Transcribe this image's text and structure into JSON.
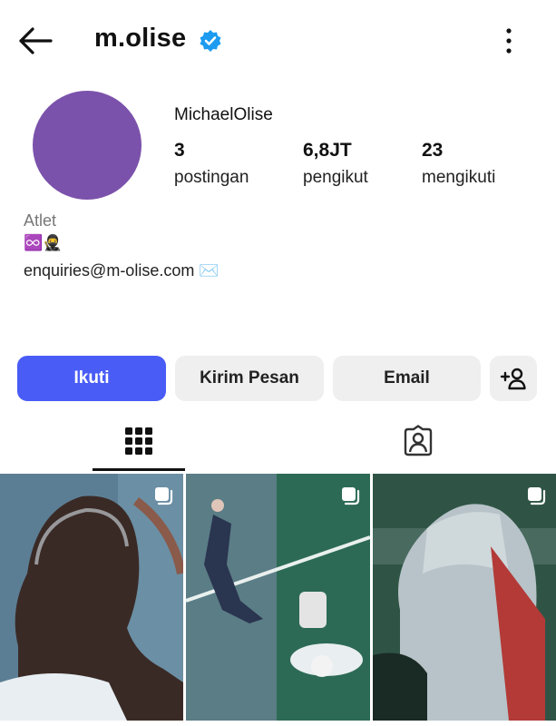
{
  "header": {
    "username": "m.olise",
    "back_icon": "arrow-left-icon",
    "verified_icon": "verified-badge-icon",
    "more_icon": "more-vertical-icon"
  },
  "profile": {
    "display_name": "MichaelOlise",
    "avatar_color": "#7b52ab",
    "stats": [
      {
        "value": "3",
        "label": "postingan"
      },
      {
        "value": "6,8JT",
        "label": "pengikut"
      },
      {
        "value": "23",
        "label": "mengikuti"
      }
    ]
  },
  "bio": {
    "category": "Atlet",
    "emoji_line": "♾️🥷",
    "email": "enquiries@m-olise.com ✉️"
  },
  "actions": {
    "follow_label": "Ikuti",
    "message_label": "Kirim Pesan",
    "email_label": "Email",
    "add_user_icon": "add-person-icon"
  },
  "tabs": {
    "active": "grid",
    "grid_icon": "grid-icon",
    "tagged_icon": "tagged-user-icon"
  },
  "colors": {
    "primary_button": "#4a5cf6",
    "secondary_button": "#efefef",
    "verified": "#1d9bf0"
  },
  "posts": [
    {
      "kind": "carousel",
      "icon": "multi-post-icon"
    },
    {
      "kind": "carousel",
      "icon": "multi-post-icon"
    },
    {
      "kind": "carousel",
      "icon": "multi-post-icon"
    }
  ]
}
